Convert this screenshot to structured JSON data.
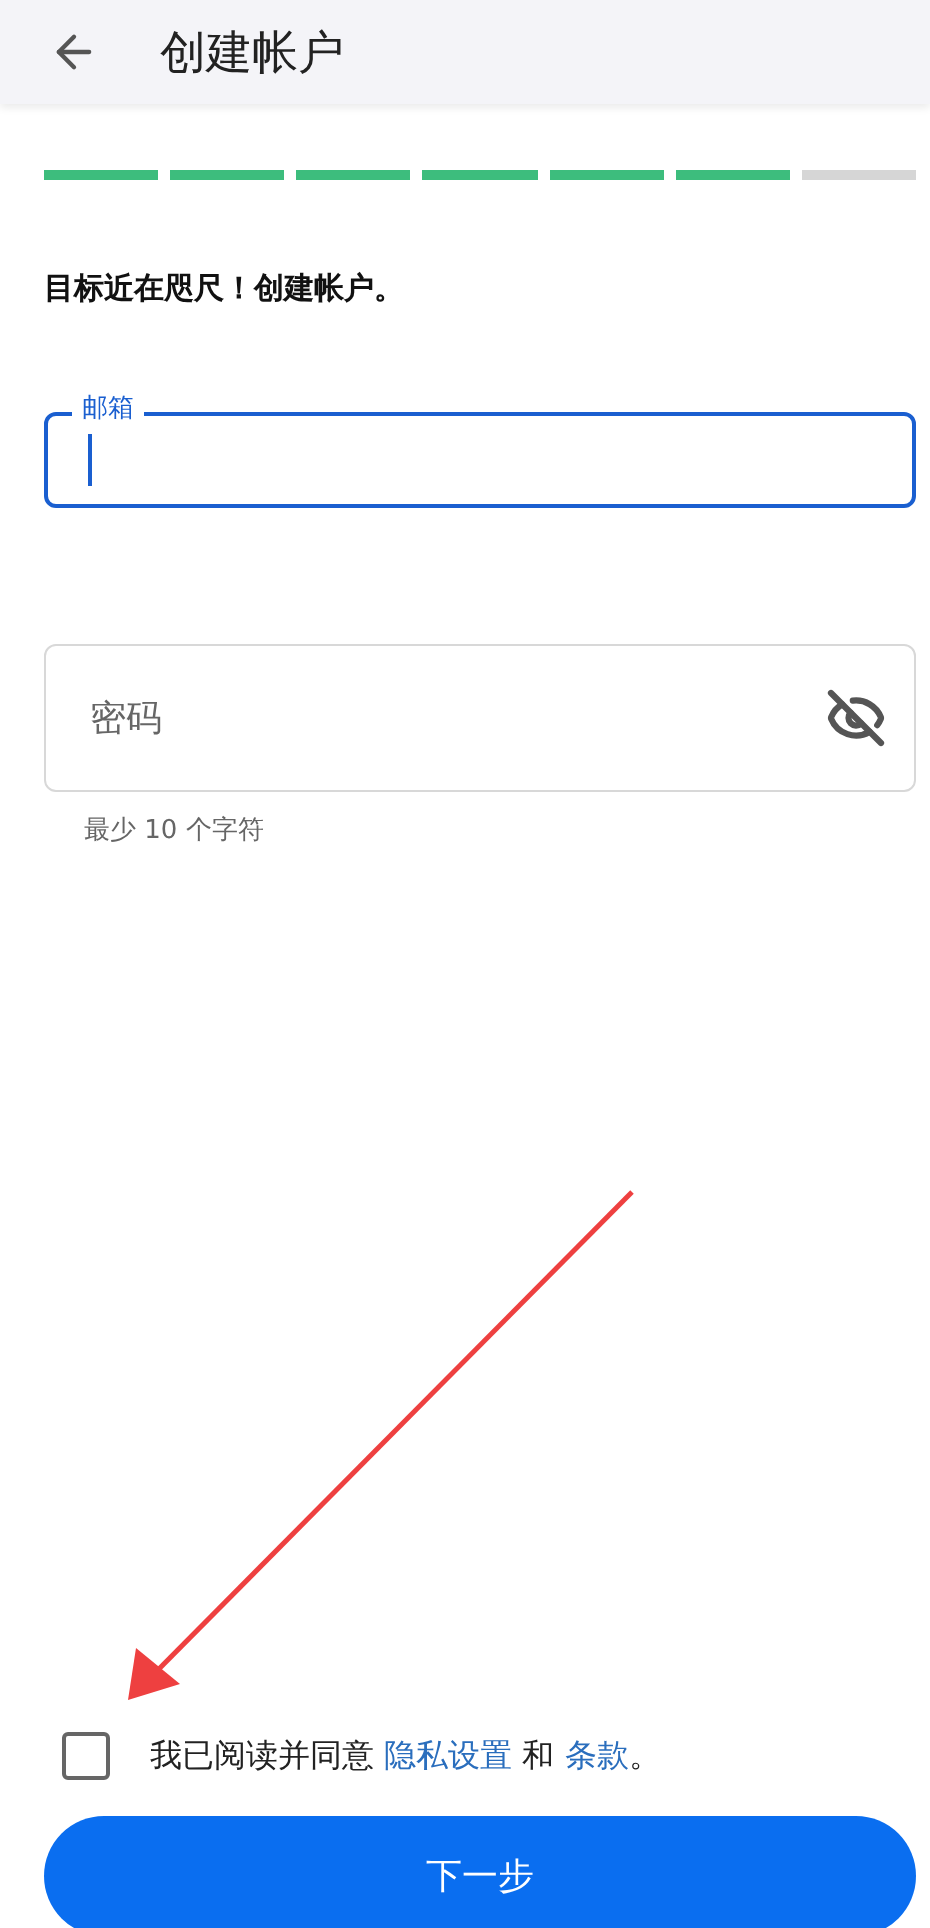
{
  "header": {
    "title": "创建帐户"
  },
  "progress": {
    "steps": [
      {
        "done": true
      },
      {
        "done": true
      },
      {
        "done": true
      },
      {
        "done": true
      },
      {
        "done": true
      },
      {
        "done": true
      },
      {
        "done": false
      }
    ]
  },
  "headline": "目标近在咫尺！创建帐户。",
  "email": {
    "label": "邮箱",
    "focused": true
  },
  "password": {
    "placeholder": "密码",
    "visible": false,
    "hint": "最少 10 个字符"
  },
  "agreement": {
    "checked": false,
    "parts": [
      {
        "kind": "text",
        "text": "我已阅读并同意 "
      },
      {
        "kind": "link",
        "text": "隐私设置"
      },
      {
        "kind": "text",
        "text": " 和 "
      },
      {
        "kind": "link",
        "text": "条款"
      },
      {
        "kind": "text",
        "text": "。"
      }
    ]
  },
  "next_button": {
    "label": "下一步"
  }
}
